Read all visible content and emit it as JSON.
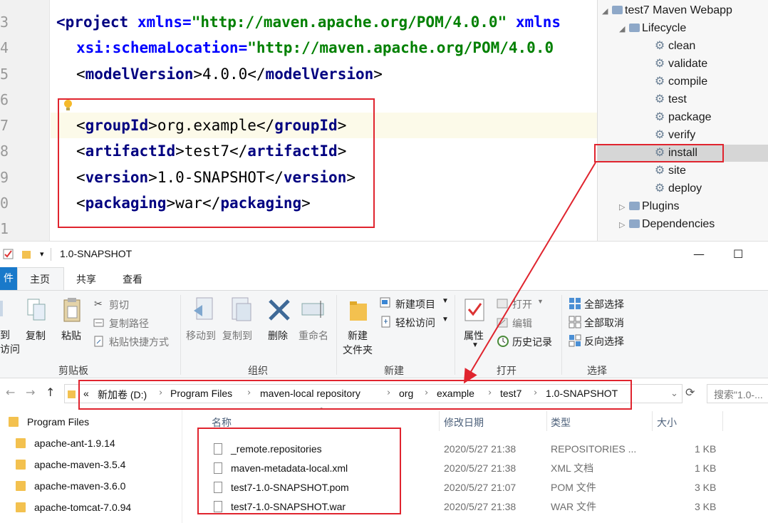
{
  "editor": {
    "line_numbers": [
      "3",
      "4",
      "5",
      "6",
      "7",
      "8",
      "9",
      "0",
      "1"
    ],
    "lines": [
      {
        "open": "<",
        "tag": "project",
        "attr": "xmlns",
        "eq": "=",
        "value": "\"http://maven.apache.org/POM/4.0.0\"",
        "tail": " xmlns"
      },
      {
        "attr": "xsi:schemaLocation",
        "eq": "=",
        "value": "\"http://maven.apache.org/POM/4.0.0"
      },
      {
        "tag": "modelVersion",
        "text": "4.0.0"
      },
      {
        "tag": "groupId",
        "text": "org.example"
      },
      {
        "tag": "artifactId",
        "text": "test7"
      },
      {
        "tag": "version",
        "text": "1.0-SNAPSHOT"
      },
      {
        "tag": "packaging",
        "text": "war"
      }
    ],
    "lt": "<",
    "gt": ">",
    "close_lt": "</"
  },
  "maven_panel": {
    "project": "test7 Maven Webapp",
    "lifecycle_label": "Lifecycle",
    "lifecycle": [
      "clean",
      "validate",
      "compile",
      "test",
      "package",
      "verify",
      "install",
      "site",
      "deploy"
    ],
    "selected": "install",
    "plugins_label": "Plugins",
    "dependencies_label": "Dependencies"
  },
  "explorer": {
    "title": "1.0-SNAPSHOT",
    "title_dropdown": "▾",
    "window_min": "—",
    "window_max": "☐",
    "tabs": {
      "file": "件",
      "home": "主页",
      "share": "共享",
      "view": "查看"
    },
    "ribbon": {
      "pin_line1": "到",
      "pin_line2": "访问",
      "copy": "复制",
      "paste": "粘贴",
      "cut": "剪切",
      "copy_path": "复制路径",
      "paste_shortcut": "粘贴快捷方式",
      "clipboard_group": "剪贴板",
      "move_to": "移动到",
      "copy_to": "复制到",
      "delete": "删除",
      "rename": "重命名",
      "organize_group": "组织",
      "new_folder_line1": "新建",
      "new_folder_line2": "文件夹",
      "new_item": "新建项目",
      "easy_access": "轻松访问",
      "new_group": "新建",
      "properties": "属性",
      "open": "打开",
      "edit": "编辑",
      "history": "历史记录",
      "open_group": "打开",
      "select_all": "全部选择",
      "select_none": "全部取消",
      "invert_selection": "反向选择",
      "select_group": "选择"
    },
    "address": {
      "overflow": "«",
      "crumbs": [
        "新加卷 (D:)",
        "Program Files",
        "maven-local repository",
        "org",
        "example",
        "test7",
        "1.0-SNAPSHOT"
      ],
      "search_placeholder": "搜索\"1.0-..."
    },
    "nav_pane": [
      "Program Files",
      "apache-ant-1.9.14",
      "apache-maven-3.5.4",
      "apache-maven-3.6.0",
      "apache-tomcat-7.0.94"
    ],
    "columns": {
      "name": "名称",
      "date": "修改日期",
      "type": "类型",
      "size": "大小"
    },
    "files": [
      {
        "name": "_remote.repositories",
        "date": "2020/5/27 21:38",
        "type": "REPOSITORIES ...",
        "size": "1 KB"
      },
      {
        "name": "maven-metadata-local.xml",
        "date": "2020/5/27 21:38",
        "type": "XML 文档",
        "size": "1 KB"
      },
      {
        "name": "test7-1.0-SNAPSHOT.pom",
        "date": "2020/5/27 21:07",
        "type": "POM 文件",
        "size": "3 KB"
      },
      {
        "name": "test7-1.0-SNAPSHOT.war",
        "date": "2020/5/27 21:38",
        "type": "WAR 文件",
        "size": "3 KB"
      }
    ]
  },
  "colors": {
    "highlight": "#e0242e",
    "xml_tag": "#000080",
    "xml_attr": "#0000ff",
    "xml_value": "#008000",
    "folder": "#f3c14f"
  }
}
